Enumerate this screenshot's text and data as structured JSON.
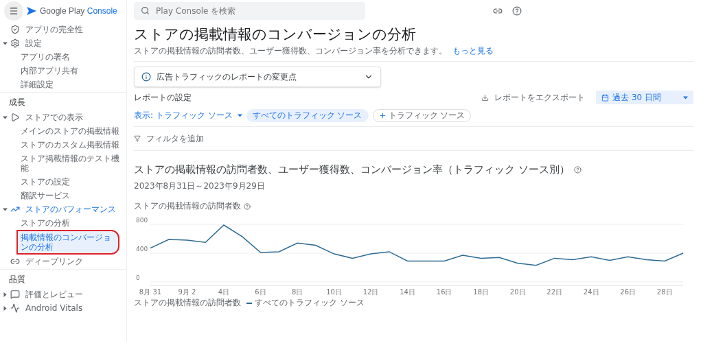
{
  "brand": {
    "name": "Google Play",
    "accent": "Console"
  },
  "sidebar": {
    "sections": [
      {
        "items": [
          {
            "label": "アプリの完全性"
          },
          {
            "label": "設定",
            "expanded": true,
            "children": [
              {
                "label": "アプリの署名",
                "selected": false
              },
              {
                "label": "内部アプリ共有",
                "selected": false
              },
              {
                "label": "詳細設定",
                "selected": false
              }
            ]
          }
        ]
      },
      {
        "heading": "成長",
        "items": [
          {
            "label": "ストアでの表示",
            "expanded": true,
            "children": [
              {
                "label": "メインのストアの掲載情報",
                "selected": false
              },
              {
                "label": "ストアのカスタム掲載情報",
                "selected": false
              },
              {
                "label": "ストア掲載情報のテスト機能",
                "selected": false
              },
              {
                "label": "ストアの設定",
                "selected": false
              },
              {
                "label": "翻訳サービス",
                "selected": false
              }
            ]
          },
          {
            "label": "ストアのパフォーマンス",
            "expanded": true,
            "children": [
              {
                "label": "ストアの分析",
                "selected": false
              },
              {
                "label": "掲載情報のコンバージョンの分析",
                "selected": true,
                "outlined": true
              }
            ]
          },
          {
            "label": "ディープリンク"
          }
        ]
      },
      {
        "heading": "品質",
        "items": [
          {
            "label": "評価とレビュー",
            "collapsible": true
          },
          {
            "label": "Android Vitals",
            "collapsible": true
          }
        ]
      }
    ]
  },
  "search": {
    "placeholder": "Play Console を検索"
  },
  "page": {
    "title": "ストアの掲載情報のコンバージョンの分析",
    "subtitle": "ストアの掲載情報の訪問者数、ユーザー獲得数、コンバージョン率を分析できます。",
    "more_link": "もっと見る"
  },
  "notice": {
    "text": "広告トラフィックのレポートの変更点",
    "expanded": false
  },
  "report_settings": {
    "heading": "レポートの設定",
    "export": "レポートをエクスポート",
    "date_range": "過去 30 日間",
    "view_selector": "表示: トラフィック ソース",
    "chips": [
      {
        "label": "すべてのトラフィック ソース",
        "kind": "filter"
      },
      {
        "label": "トラフィック ソース",
        "kind": "add"
      }
    ],
    "add_filter": "フィルタを追加"
  },
  "section": {
    "title": "ストアの掲載情報の訪問者数、ユーザー獲得数、コンバージョン率（トラフィック ソース別）",
    "date": "2023年8月31日～2023年9月29日",
    "legend_label": "ストアの掲載情報の訪問者数",
    "chart_data": {
      "type": "line",
      "title": "ストアの掲載情報の訪問者数",
      "x": [
        0,
        1,
        2,
        3,
        4,
        5,
        6,
        7,
        8,
        9,
        10,
        11,
        12,
        13,
        14,
        15,
        16,
        17,
        18,
        19,
        20,
        21,
        22,
        23,
        24,
        25,
        26,
        27,
        28,
        29
      ],
      "series": [
        {
          "name": "すべてのトラフィック ソース",
          "color": "#2b6a94",
          "values": [
            470,
            590,
            580,
            550,
            790,
            630,
            410,
            420,
            540,
            510,
            390,
            330,
            390,
            420,
            290,
            290,
            290,
            370,
            330,
            340,
            260,
            230,
            330,
            310,
            350,
            300,
            350,
            310,
            290,
            400
          ]
        }
      ],
      "xlim": [
        0,
        29
      ],
      "ylim": [
        0,
        800
      ],
      "yticks": [
        0,
        400,
        800
      ],
      "xticks": [
        {
          "value": 0,
          "label": "8月 31"
        },
        {
          "value": 2,
          "label": "9月 2"
        },
        {
          "value": 4,
          "label": "4日"
        },
        {
          "value": 6,
          "label": "6日"
        },
        {
          "value": 8,
          "label": "8日"
        },
        {
          "value": 10,
          "label": "10日"
        },
        {
          "value": 12,
          "label": "12日"
        },
        {
          "value": 14,
          "label": "14日"
        },
        {
          "value": 16,
          "label": "16日"
        },
        {
          "value": 18,
          "label": "18日"
        },
        {
          "value": 20,
          "label": "20日"
        },
        {
          "value": 22,
          "label": "22日"
        },
        {
          "value": 24,
          "label": "24日"
        },
        {
          "value": 26,
          "label": "26日"
        },
        {
          "value": 28,
          "label": "28日"
        }
      ]
    }
  }
}
